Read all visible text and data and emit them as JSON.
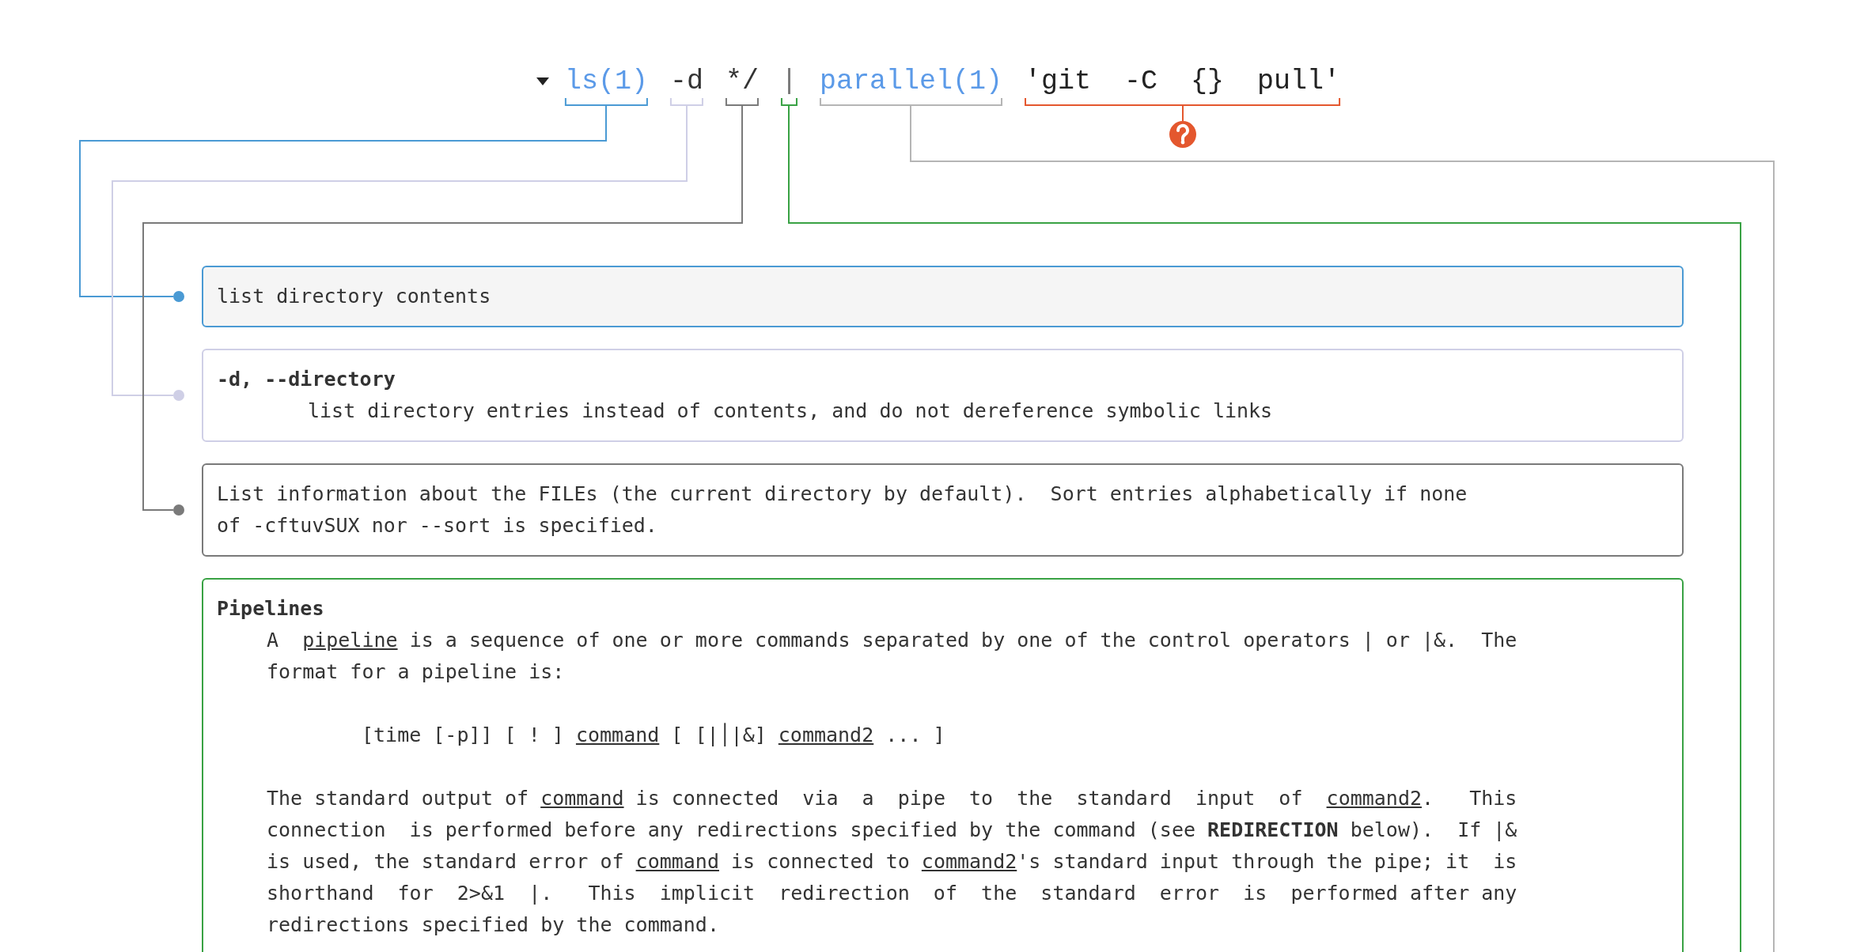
{
  "command": {
    "tokens": [
      {
        "text": "ls(1)",
        "kind": "link",
        "color": "#4a9ad4"
      },
      {
        "text": "-d",
        "kind": "plain",
        "color": "#cfcfe6"
      },
      {
        "text": "*/",
        "kind": "plain",
        "color": "#7a7a7a"
      },
      {
        "text": "|",
        "kind": "plain",
        "color": "#39a244"
      },
      {
        "text": "parallel(1)",
        "kind": "link",
        "color": "#b5b5b5"
      },
      {
        "text": "'git  -C  {}  pull'",
        "kind": "unknown",
        "color": "#e4572e"
      }
    ]
  },
  "explanations": [
    {
      "kind": "summary",
      "text": "list directory contents"
    },
    {
      "kind": "option",
      "term": "-d, --directory",
      "text": "list directory entries instead of contents, and do not dereference symbolic links"
    },
    {
      "kind": "text",
      "text": "List information about the FILEs (the current directory by default).  Sort entries alphabetically if none\nof -cftuvSUX nor --sort is specified."
    },
    {
      "kind": "section",
      "title": "Pipelines",
      "paragraphs": [
        {
          "kind": "body",
          "segments": [
            {
              "kind": "plain",
              "text": "A  "
            },
            {
              "kind": "underlined",
              "text": "pipeline"
            },
            {
              "kind": "plain",
              "text": " is a sequence of one or more commands separated by one of the control operators | or |&.  The\nformat for a pipeline is:"
            }
          ]
        },
        {
          "kind": "synopsis",
          "segments": [
            {
              "kind": "plain",
              "text": "[time [-p]] [ ! ] "
            },
            {
              "kind": "underlined",
              "text": "command"
            },
            {
              "kind": "plain",
              "text": " [ [|│|&] "
            },
            {
              "kind": "underlined",
              "text": "command2"
            },
            {
              "kind": "plain",
              "text": " ... ]"
            }
          ]
        },
        {
          "kind": "body",
          "segments": [
            {
              "kind": "plain",
              "text": "The standard output of "
            },
            {
              "kind": "underlined",
              "text": "command"
            },
            {
              "kind": "plain",
              "text": " is connected  via  a  pipe  to  the  standard  input  of  "
            },
            {
              "kind": "underlined",
              "text": "command2"
            },
            {
              "kind": "plain",
              "text": ".   This\nconnection  is performed before any redirections specified by the command (see **REDIRECTION** below).  If |&\nis used, the standard error of "
            },
            {
              "kind": "underlined",
              "text": "command"
            },
            {
              "kind": "plain",
              "text": " is connected to "
            },
            {
              "kind": "underlined",
              "text": "command2"
            },
            {
              "kind": "plain",
              "text": "'s standard input through the pipe; it  is\nshorthand  for  2>&1  |.   This  implicit  redirection  of  the  standard  error  is  performed after any\nredirections specified by the command."
            }
          ]
        }
      ]
    }
  ]
}
